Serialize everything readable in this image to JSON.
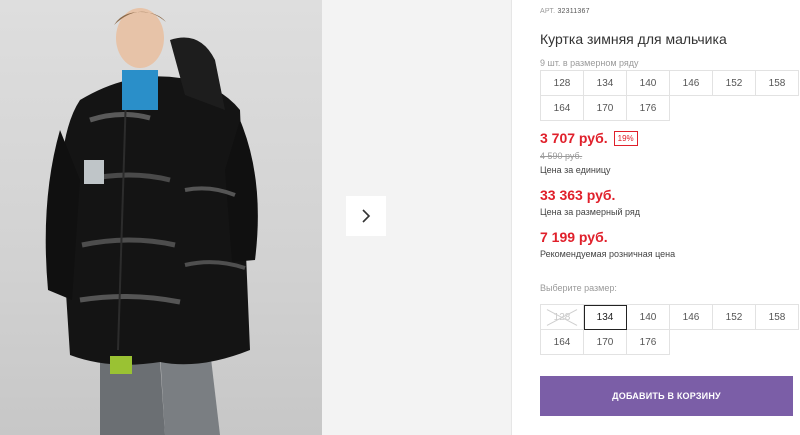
{
  "gallery": {
    "photo_alt": "boy-in-black-winter-jacket",
    "next_icon": "chevron-right-icon"
  },
  "product": {
    "article_label": "АРТ.",
    "article_code": "32311367",
    "title": "Куртка зимняя для мальчика",
    "size_count": "9 шт. в размерном ряду",
    "size_row_sizes": [
      "128",
      "134",
      "140",
      "146",
      "152",
      "158",
      "164",
      "170",
      "176"
    ]
  },
  "prices": {
    "unit_price": "3 707 руб.",
    "discount": "19%",
    "old_price": "4 590 руб.",
    "unit_label": "Цена за единицу",
    "row_price": "33 363 руб.",
    "row_label": "Цена за размерный ряд",
    "retail_price": "7 199 руб.",
    "retail_label": "Рекомендуемая розничная цена",
    "price_color": "#e0202b"
  },
  "size_select": {
    "label": "Выберите размер:",
    "options": [
      "128",
      "134",
      "140",
      "146",
      "152",
      "158",
      "164",
      "170",
      "176"
    ],
    "selected": "134",
    "unavailable": [
      "128"
    ]
  },
  "cart": {
    "add_label": "ДОБАВИТЬ В КОРЗИНУ",
    "button_color": "#7b5ea7"
  }
}
